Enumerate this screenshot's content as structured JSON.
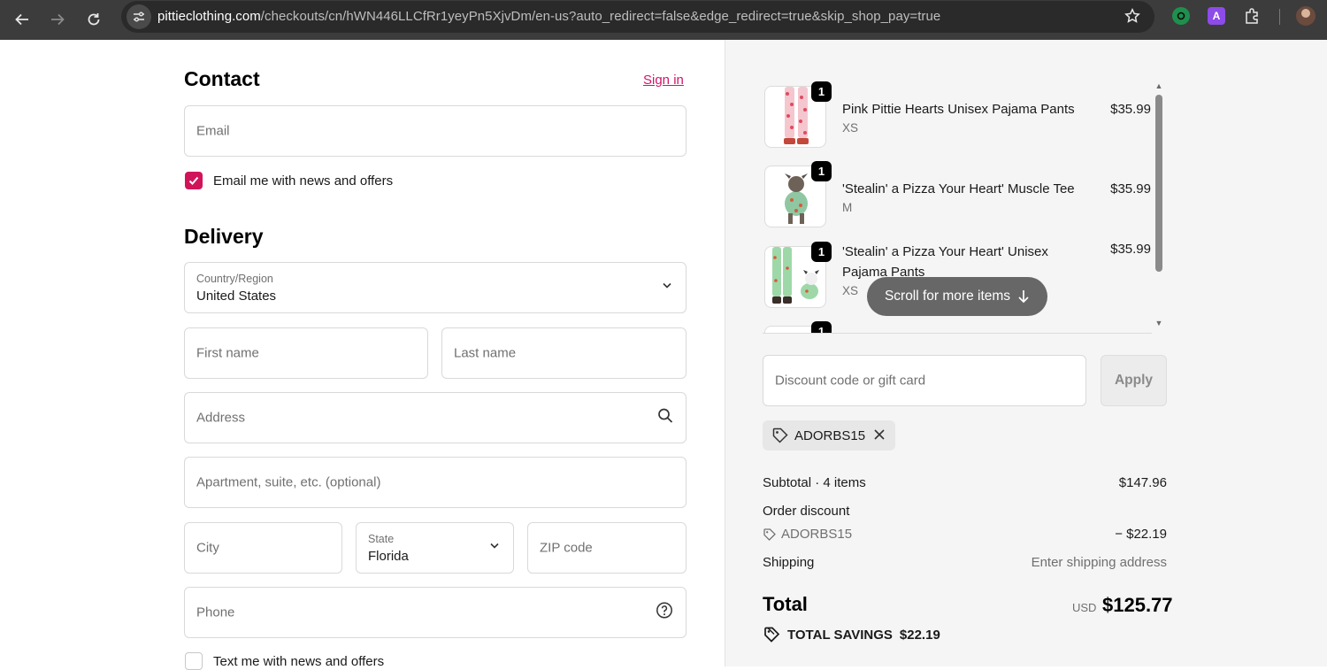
{
  "browser": {
    "url_host": "pittieclothing.com",
    "url_path": "/checkouts/cn/hWN446LLCfRr1yeyPn5XjvDm/en-us?auto_redirect=false&edge_redirect=true&skip_shop_pay=true",
    "ext_purple_letter": "A"
  },
  "contact": {
    "title": "Contact",
    "signin_label": "Sign in",
    "email_placeholder": "Email",
    "news_checkbox_label": "Email me with news and offers",
    "news_checked": true
  },
  "delivery": {
    "title": "Delivery",
    "country_label": "Country/Region",
    "country_value": "United States",
    "first_name_placeholder": "First name",
    "last_name_placeholder": "Last name",
    "address_placeholder": "Address",
    "apartment_placeholder": "Apartment, suite, etc. (optional)",
    "city_placeholder": "City",
    "state_label": "State",
    "state_value": "Florida",
    "zip_placeholder": "ZIP code",
    "phone_placeholder": "Phone",
    "text_checkbox_label": "Text me with news and offers",
    "text_checked": false
  },
  "cart": {
    "items": [
      {
        "name": "Pink Pittie Hearts Unisex Pajama Pants",
        "variant": "XS",
        "price": "$35.99",
        "qty": "1"
      },
      {
        "name": "'Stealin' a Pizza Your Heart' Muscle Tee",
        "variant": "M",
        "price": "$35.99",
        "qty": "1"
      },
      {
        "name": "'Stealin' a Pizza Your Heart' Unisex Pajama Pants",
        "variant": "XS",
        "price": "$35.99",
        "qty": "1"
      },
      {
        "name": "",
        "variant": "",
        "price": "",
        "qty": "1"
      }
    ],
    "scroll_hint": "Scroll for more items",
    "discount_placeholder": "Discount code or gift card",
    "apply_label": "Apply",
    "applied_code": "ADORBS15"
  },
  "summary": {
    "subtotal_label": "Subtotal · 4 items",
    "subtotal_value": "$147.96",
    "order_discount_label": "Order discount",
    "discount_code": "ADORBS15",
    "discount_value": "− $22.19",
    "shipping_label": "Shipping",
    "shipping_value": "Enter shipping address",
    "total_label": "Total",
    "currency": "USD",
    "total_value": "$125.77",
    "savings_label": "TOTAL SAVINGS",
    "savings_value": "$22.19"
  },
  "colors": {
    "accent": "#d1145a",
    "link": "#d1146a",
    "sidebar_bg": "#f5f5f5"
  }
}
